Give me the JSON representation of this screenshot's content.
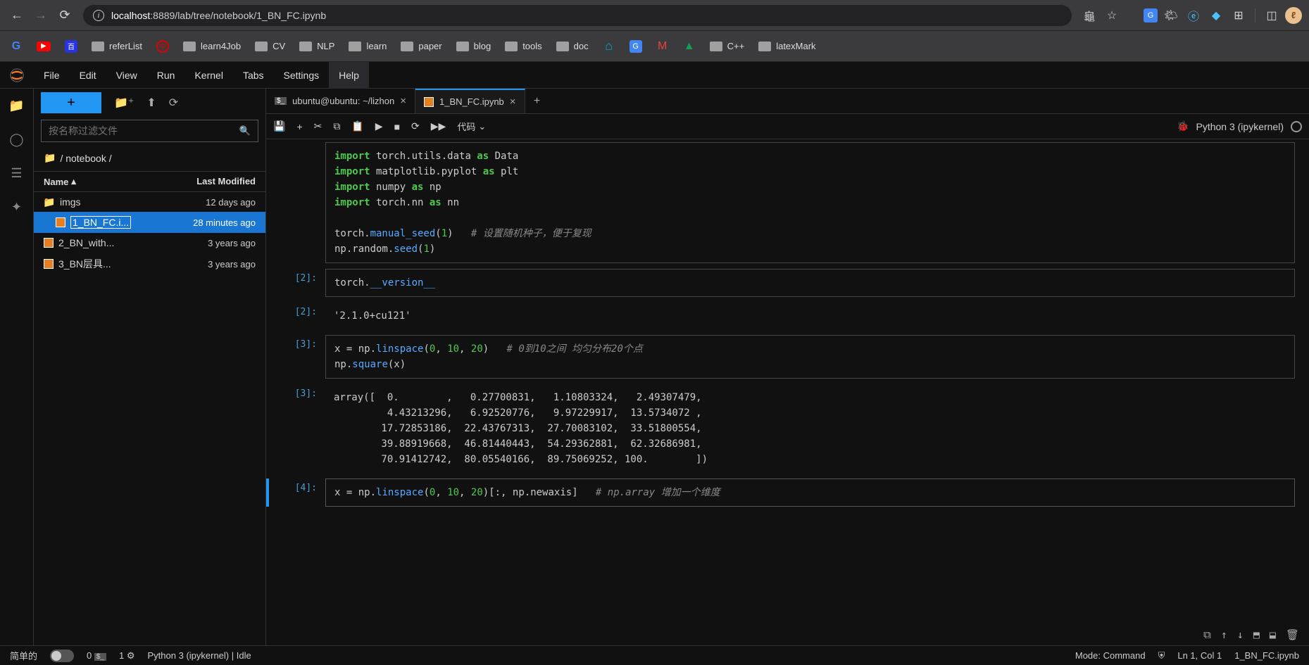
{
  "browser": {
    "url_host": "localhost",
    "url_path": ":8889/lab/tree/notebook/1_BN_FC.ipynb"
  },
  "bookmarks": [
    {
      "label": "referList",
      "type": "folder"
    },
    {
      "label": "",
      "type": "icon"
    },
    {
      "label": "learn4Job",
      "type": "folder"
    },
    {
      "label": "CV",
      "type": "folder"
    },
    {
      "label": "NLP",
      "type": "folder"
    },
    {
      "label": "learn",
      "type": "folder"
    },
    {
      "label": "paper",
      "type": "folder"
    },
    {
      "label": "blog",
      "type": "folder"
    },
    {
      "label": "tools",
      "type": "folder"
    },
    {
      "label": "doc",
      "type": "folder"
    },
    {
      "label": "C++",
      "type": "folder"
    },
    {
      "label": "latexMark",
      "type": "folder"
    }
  ],
  "menu": [
    "File",
    "Edit",
    "View",
    "Run",
    "Kernel",
    "Tabs",
    "Settings",
    "Help"
  ],
  "file_panel": {
    "search_placeholder": "按名称过滤文件",
    "crumb": "/ notebook /",
    "head_name": "Name",
    "head_mod": "Last Modified",
    "rows": [
      {
        "name": "imgs",
        "mod": "12 days ago",
        "type": "dir"
      },
      {
        "name": "1_BN_FC.i...",
        "mod": "28 minutes ago",
        "type": "nb",
        "selected": true,
        "running": true
      },
      {
        "name": "2_BN_with...",
        "mod": "3 years ago",
        "type": "nb"
      },
      {
        "name": "3_BN层具...",
        "mod": "3 years ago",
        "type": "nb"
      }
    ]
  },
  "tabs": [
    {
      "label": "ubuntu@ubuntu: ~/lizhon",
      "icon": "term"
    },
    {
      "label": "1_BN_FC.ipynb",
      "icon": "nb",
      "active": true
    }
  ],
  "toolbar": {
    "celltype": "代码"
  },
  "kernel": {
    "name": "Python 3 (ipykernel)"
  },
  "cells": {
    "c1_prompt": "",
    "c1_code": "import torch.utils.data as Data\nimport matplotlib.pyplot as plt\nimport numpy as np\nimport torch.nn as nn\n\ntorch.manual_seed(1)   # 设置随机种子，便于复现\nnp.random.seed(1)",
    "c2_prompt": "[2]:",
    "c2_code": "torch.__version__",
    "c2_out_prompt": "[2]:",
    "c2_out": "'2.1.0+cu121'",
    "c3_prompt": "[3]:",
    "c3_code": "x = np.linspace(0, 10, 20)   # 0到10之间 均匀分布20个点\nnp.square(x)",
    "c3_out_prompt": "[3]:",
    "c3_out": "array([  0.        ,   0.27700831,   1.10803324,   2.49307479,\n         4.43213296,   6.92520776,   9.97229917,  13.5734072 ,\n        17.72853186,  22.43767313,  27.70083102,  33.51800554,\n        39.88919668,  46.81440443,  54.29362881,  62.32686981,\n        70.91412742,  80.05540166,  89.75069252, 100.        ])",
    "c4_prompt": "[4]:",
    "c4_code": "x = np.linspace(0, 10, 20)[:, np.newaxis]   # np.array 增加一个维度"
  },
  "status": {
    "left1": "简单的",
    "count0": "0",
    "count1": "1",
    "kernel": "Python 3 (ipykernel) | Idle",
    "mode": "Mode: Command",
    "pos": "Ln 1, Col 1",
    "file": "1_BN_FC.ipynb"
  }
}
